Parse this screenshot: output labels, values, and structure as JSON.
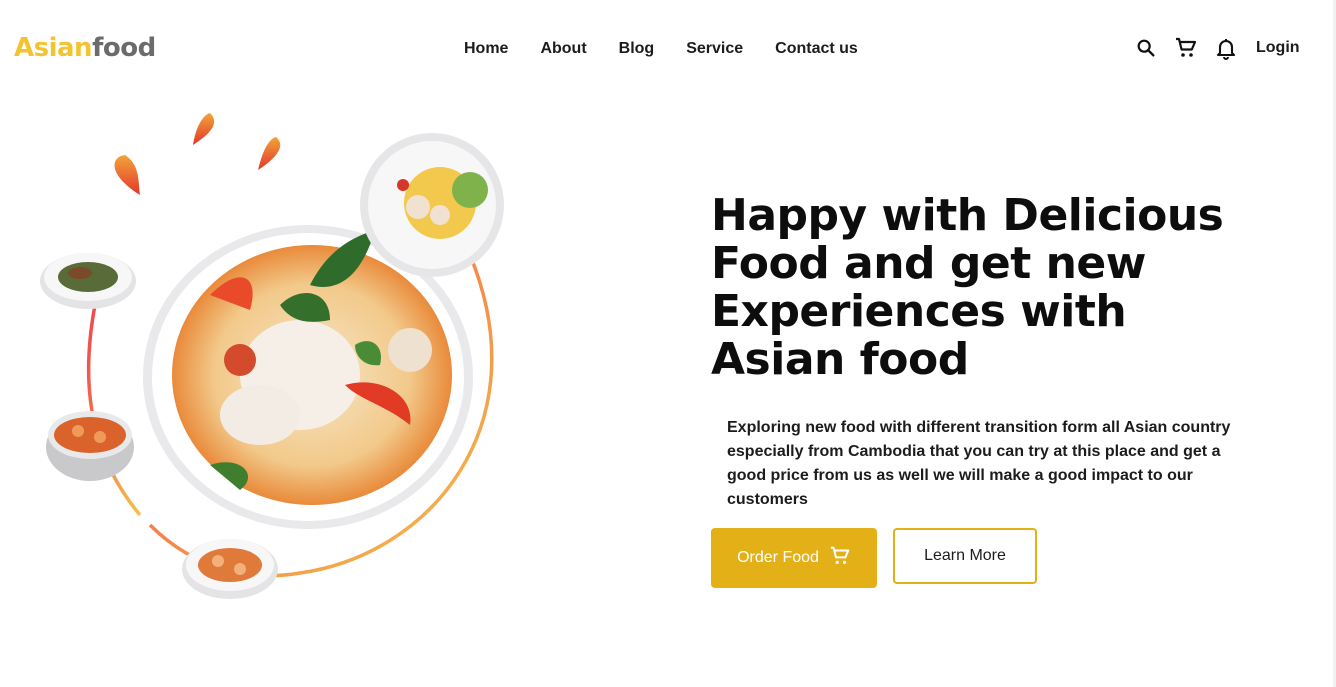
{
  "brand": {
    "logo_part1": "Asian",
    "logo_part2": "food",
    "color_primary": "#f4c430",
    "color_secondary": "#6b6b6b"
  },
  "nav": {
    "items": [
      {
        "label": "Home"
      },
      {
        "label": "About"
      },
      {
        "label": "Blog"
      },
      {
        "label": "Service"
      },
      {
        "label": "Contact us"
      }
    ]
  },
  "header_actions": {
    "icons": [
      "search-icon",
      "cart-icon",
      "bell-icon"
    ],
    "login_label": "Login"
  },
  "hero": {
    "headline": "Happy with Delicious Food and get new Experiences with Asian food",
    "description": "Exploring new food with different transition form all Asian country especially from Cambodia that you can try at this place and get a good price from us as well we will make a good impact to our customers",
    "order_button_label": "Order Food",
    "order_button_icon": "cart-icon",
    "learn_button_label": "Learn More",
    "accent_color": "#e3b018"
  }
}
